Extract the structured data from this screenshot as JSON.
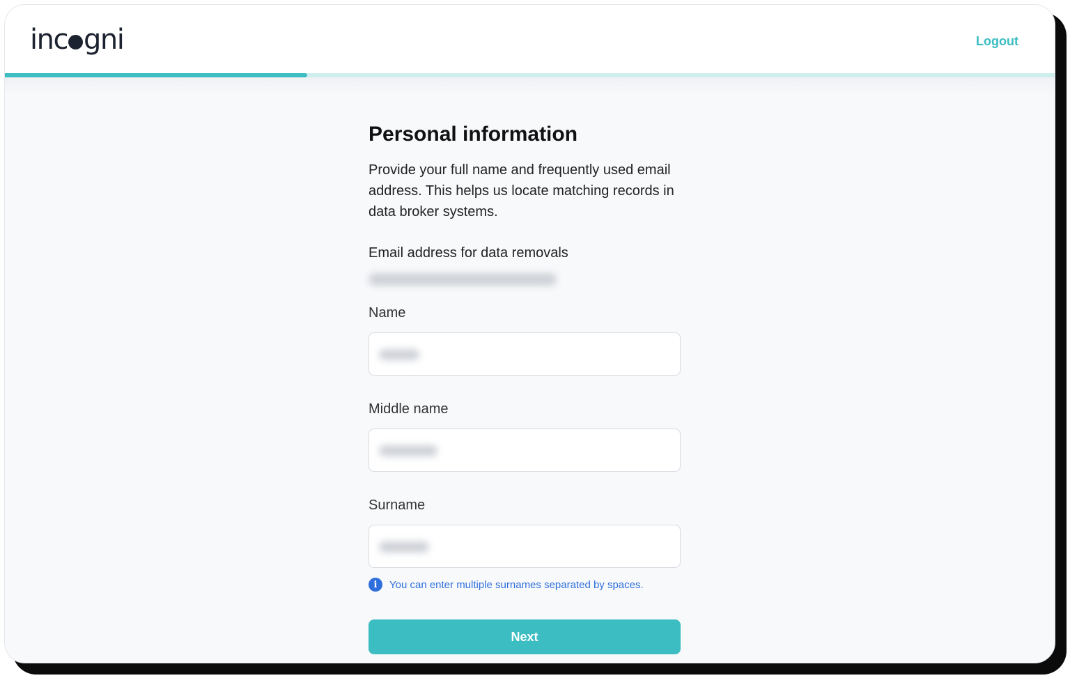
{
  "header": {
    "logo_text_pre": "inc",
    "logo_text_post": "gni",
    "logout_label": "Logout"
  },
  "progress": {
    "fraction": 0.288
  },
  "form": {
    "title": "Personal information",
    "description": "Provide your full name and frequently used email address. This helps us locate matching records in data broker systems.",
    "email_label": "Email address for data removals",
    "name_label": "Name",
    "middle_name_label": "Middle name",
    "surname_label": "Surname",
    "surname_hint": "You can enter multiple surnames separated by spaces.",
    "next_label": "Next"
  },
  "colors": {
    "accent": "#3bbdc2",
    "hint": "#2f6fdc"
  }
}
